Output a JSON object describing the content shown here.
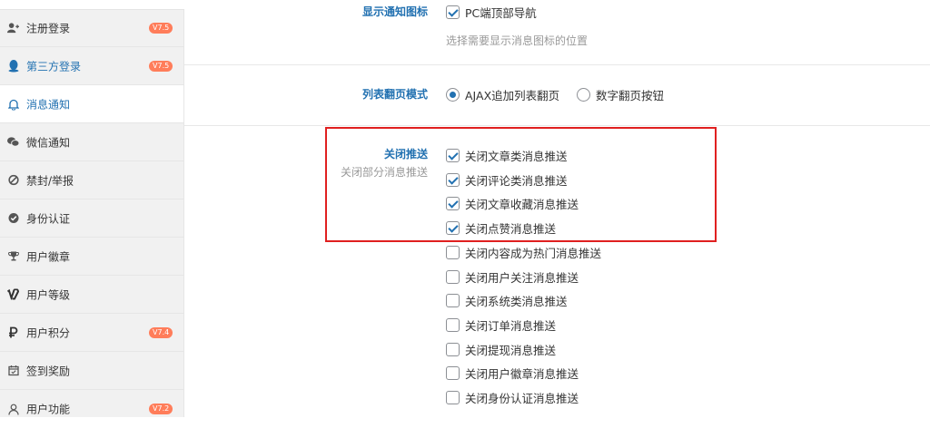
{
  "colors": {
    "accent": "#2271b1",
    "badge": "#ff7d5a",
    "highlight": "#e02020"
  },
  "sidebar": {
    "items": [
      {
        "icon": "user-plus-icon",
        "label": "注册登录",
        "badge": "V7.5"
      },
      {
        "icon": "qq-penguin-icon",
        "label": "第三方登录",
        "badge": "V7.5"
      },
      {
        "icon": "bell-icon",
        "label": "消息通知",
        "badge": "",
        "active": true
      },
      {
        "icon": "wechat-icon",
        "label": "微信通知",
        "badge": ""
      },
      {
        "icon": "ban-icon",
        "label": "禁封/举报",
        "badge": ""
      },
      {
        "icon": "check-circle-icon",
        "label": "身份认证",
        "badge": ""
      },
      {
        "icon": "trophy-icon",
        "label": "用户徽章",
        "badge": ""
      },
      {
        "icon": "vimeo-v-icon",
        "label": "用户等级",
        "badge": ""
      },
      {
        "icon": "ruble-icon",
        "label": "用户积分",
        "badge": "V7.4"
      },
      {
        "icon": "calendar-check-icon",
        "label": "签到奖励",
        "badge": ""
      },
      {
        "icon": "user-icon",
        "label": "用户功能",
        "badge": "V7.2"
      }
    ]
  },
  "main": {
    "notify_icon": {
      "label": "显示通知图标",
      "option": "PC端顶部导航",
      "checked": true,
      "help": "选择需要显示消息图标的位置"
    },
    "pagination": {
      "label": "列表翻页模式",
      "options": [
        {
          "label": "AJAX追加列表翻页",
          "checked": true
        },
        {
          "label": "数字翻页按钮",
          "checked": false
        }
      ]
    },
    "close_push": {
      "label": "关闭推送",
      "desc": "关闭部分消息推送",
      "options": [
        {
          "label": "关闭文章类消息推送",
          "checked": true
        },
        {
          "label": "关闭评论类消息推送",
          "checked": true
        },
        {
          "label": "关闭文章收藏消息推送",
          "checked": true
        },
        {
          "label": "关闭点赞消息推送",
          "checked": true
        },
        {
          "label": "关闭内容成为热门消息推送",
          "checked": false
        },
        {
          "label": "关闭用户关注消息推送",
          "checked": false
        },
        {
          "label": "关闭系统类消息推送",
          "checked": false
        },
        {
          "label": "关闭订单消息推送",
          "checked": false
        },
        {
          "label": "关闭提现消息推送",
          "checked": false
        },
        {
          "label": "关闭用户徽章消息推送",
          "checked": false
        },
        {
          "label": "关闭身份认证消息推送",
          "checked": false
        }
      ]
    }
  }
}
